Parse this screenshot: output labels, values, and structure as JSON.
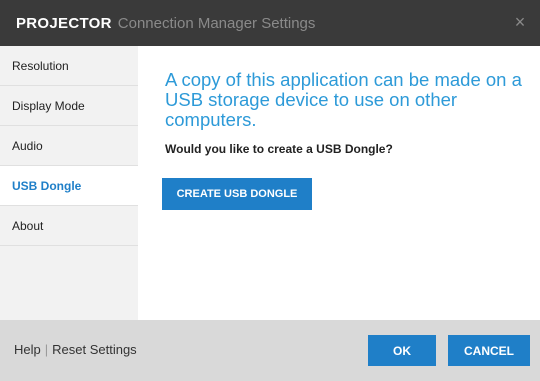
{
  "window": {
    "title_strong": "PROJECTOR",
    "title_sub": "Connection Manager Settings",
    "close_icon": "×"
  },
  "sidebar": {
    "items": [
      {
        "label": "Resolution"
      },
      {
        "label": "Display Mode"
      },
      {
        "label": "Audio"
      },
      {
        "label": "USB Dongle",
        "active": true
      },
      {
        "label": "About"
      }
    ]
  },
  "main": {
    "headline": "A copy of this application can be made on a USB storage device to use on other computers.",
    "question": "Would you like to create a USB Dongle?",
    "create_button": "CREATE USB DONGLE"
  },
  "footer": {
    "help": "Help",
    "separator": "|",
    "reset": "Reset Settings",
    "ok": "OK",
    "cancel": "CANCEL"
  },
  "colors": {
    "accent": "#1f7fc8",
    "headline": "#2d9ad8",
    "titlebar": "#3a3a3a",
    "sidebar": "#f2f2f2",
    "footer": "#d9d9d9"
  }
}
